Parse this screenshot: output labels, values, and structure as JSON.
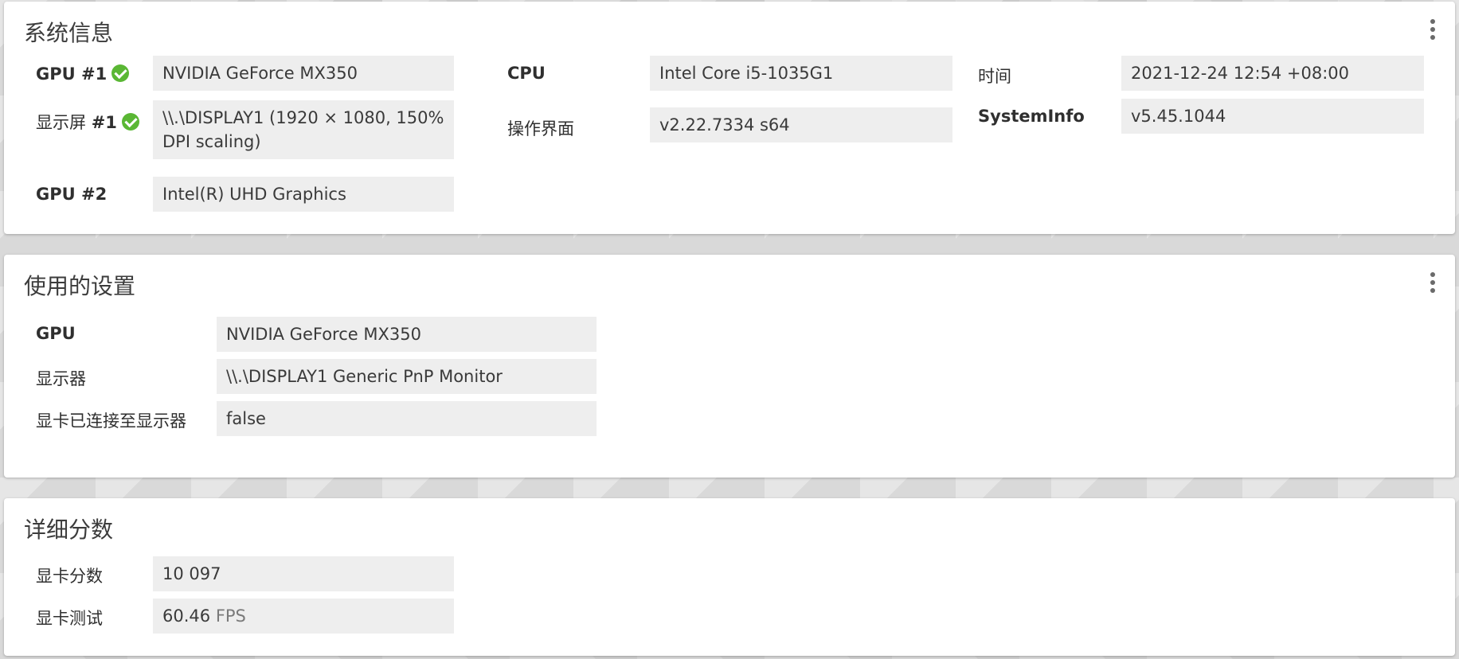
{
  "system_info": {
    "title": "系统信息",
    "rows": {
      "gpu1_label": "GPU #1",
      "gpu1_value": "NVIDIA GeForce MX350",
      "display1_label_prefix": "显示屏 ",
      "display1_label_num": "#1",
      "display1_value": "\\\\.\\DISPLAY1 (1920 × 1080, 150% DPI scaling)",
      "gpu2_label": "GPU #2",
      "gpu2_value": "Intel(R) UHD Graphics",
      "cpu_label": "CPU",
      "cpu_value": "Intel Core i5-1035G1",
      "gui_label": "操作界面",
      "gui_value": "v2.22.7334 s64",
      "time_label": "时间",
      "time_value": "2021-12-24 12:54 +08:00",
      "sysinfo_label": "SystemInfo",
      "sysinfo_value": "v5.45.1044"
    }
  },
  "settings_used": {
    "title": "使用的设置",
    "gpu_label": "GPU",
    "gpu_value": "NVIDIA GeForce MX350",
    "display_label": "显示器",
    "display_value": "\\\\.\\DISPLAY1 Generic PnP Monitor",
    "connected_label": "显卡已连接至显示器",
    "connected_value": "false"
  },
  "detailed_scores": {
    "title": "详细分数",
    "gpu_score_label": "显卡分数",
    "gpu_score_value": "10 097",
    "gpu_test_label": "显卡测试",
    "gpu_test_value": "60.46",
    "gpu_test_unit": "FPS"
  },
  "icons": {
    "check": "check-circle-icon",
    "menu": "more-vertical-icon"
  },
  "colors": {
    "check_green": "#5ab734",
    "value_bg": "#eeeeee"
  }
}
